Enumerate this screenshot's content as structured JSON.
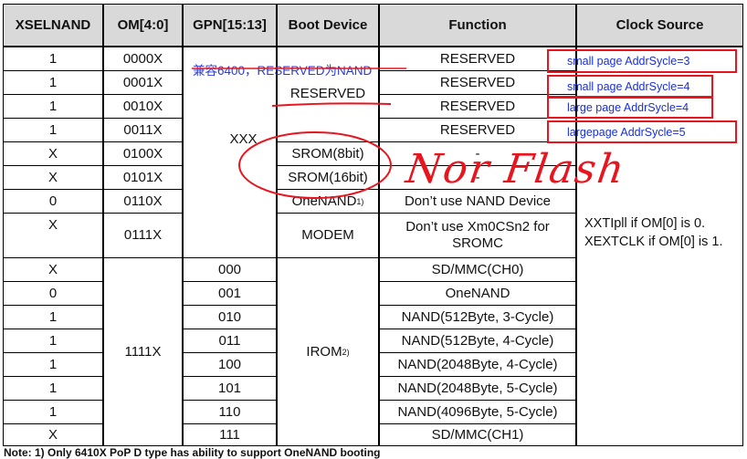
{
  "headers": {
    "xselnand": "XSELNAND",
    "om": "OM[4:0]",
    "gpn": "GPN[15:13]",
    "boot": "Boot Device",
    "function": "Function",
    "clock": "Clock Source"
  },
  "rows": [
    {
      "xsel": "1",
      "om": "0000X",
      "func": "RESERVED"
    },
    {
      "xsel": "1",
      "om": "0001X",
      "func": "RESERVED"
    },
    {
      "xsel": "1",
      "om": "0010X",
      "func": "RESERVED"
    },
    {
      "xsel": "1",
      "om": "0011X",
      "func": "RESERVED"
    },
    {
      "xsel": "X",
      "om": "0100X",
      "func": "-"
    },
    {
      "xsel": "X",
      "om": "0101X",
      "func": "-"
    },
    {
      "xsel": "0",
      "om": "0110X",
      "func": "Don’t use NAND Device"
    },
    {
      "xsel": "X",
      "om": "0111X",
      "func": "Don’t use Xm0CSn2 for SROMC"
    },
    {
      "xsel": "X",
      "gpn": "000",
      "func": "SD/MMC(CH0)"
    },
    {
      "xsel": "0",
      "gpn": "001",
      "func": "OneNAND"
    },
    {
      "xsel": "1",
      "gpn": "010",
      "func": "NAND(512Byte, 3-Cycle)"
    },
    {
      "xsel": "1",
      "gpn": "011",
      "func": "NAND(512Byte, 4-Cycle)"
    },
    {
      "xsel": "1",
      "gpn": "100",
      "func": "NAND(2048Byte, 4-Cycle)"
    },
    {
      "xsel": "1",
      "gpn": "101",
      "func": "NAND(2048Byte, 5-Cycle)"
    },
    {
      "xsel": "1",
      "gpn": "110",
      "func": "NAND(4096Byte, 5-Cycle)"
    },
    {
      "xsel": "X",
      "gpn": "111",
      "func": "SD/MMC(CH1)"
    }
  ],
  "gpn_merged": "XXX",
  "om_merged": "1111X",
  "boot": {
    "reserved": "RESERVED",
    "srom8": "SROM(8bit)",
    "srom16": "SROM(16bit)",
    "onenand": "OneNAND",
    "onenand_sup": "1)",
    "modem": "MODEM",
    "irom": "IROM",
    "irom_sup": "2)"
  },
  "clock_text": "XXTIpll if OM[0] is 0. XEXTCLK if OM[0] is 1.",
  "annotations": {
    "chinese_note": "兼容6400，RESERVED为NAND",
    "boxes": [
      "small page AddrSycle=3",
      "small page AddrSycle=4",
      "large page AddrSycle=4",
      "largepage AddrSycle=5"
    ],
    "handwriting": "Nor Flash"
  },
  "footnote": "Note: 1) Only 6410X PoP D type has ability to support OneNAND booting",
  "colors": {
    "header_bg": "#d9d9d9",
    "annotation_red": "#e8141e",
    "annotation_blue": "#1a2fd6"
  }
}
